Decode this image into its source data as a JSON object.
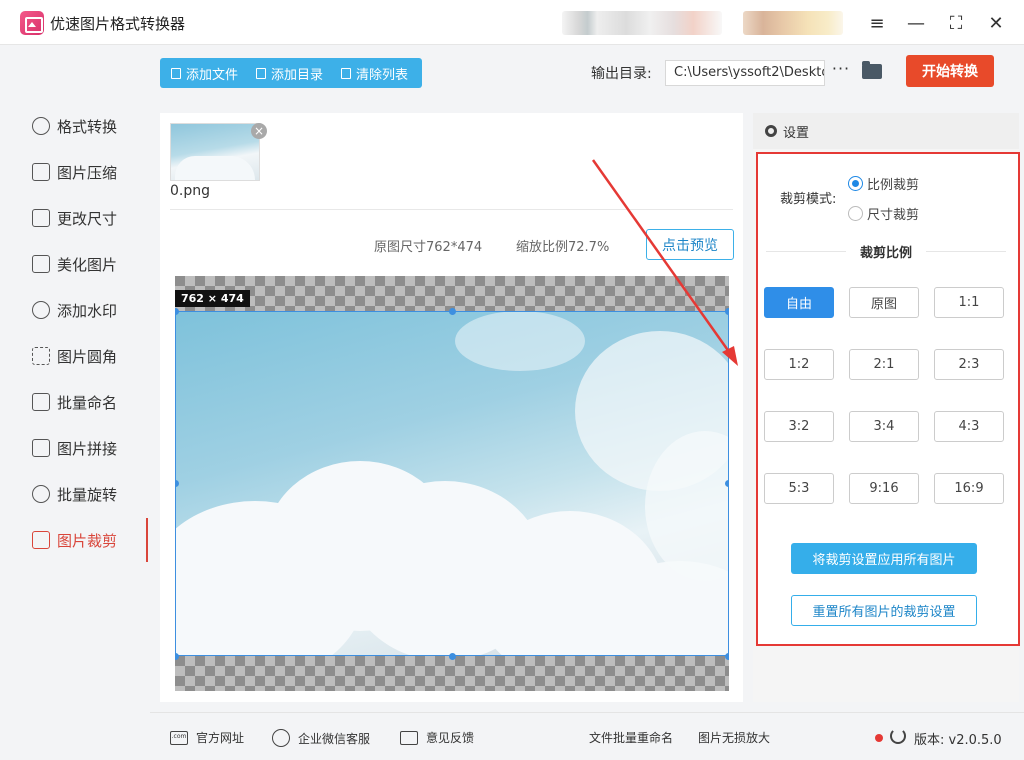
{
  "app": {
    "title": "优速图片格式转换器"
  },
  "window_controls": {
    "menu": "≡",
    "minimize": "—",
    "maximize": "⛶",
    "close": "✕"
  },
  "sidebar": {
    "items": [
      {
        "label": "格式转换",
        "icon": "convert-icon"
      },
      {
        "label": "图片压缩",
        "icon": "compress-icon"
      },
      {
        "label": "更改尺寸",
        "icon": "resize-icon"
      },
      {
        "label": "美化图片",
        "icon": "beautify-icon"
      },
      {
        "label": "添加水印",
        "icon": "watermark-icon"
      },
      {
        "label": "图片圆角",
        "icon": "rounded-corner-icon"
      },
      {
        "label": "批量命名",
        "icon": "rename-icon"
      },
      {
        "label": "图片拼接",
        "icon": "stitch-icon"
      },
      {
        "label": "批量旋转",
        "icon": "rotate-icon"
      },
      {
        "label": "图片裁剪",
        "icon": "crop-icon",
        "active": true
      }
    ]
  },
  "toolbar": {
    "add_file": "添加文件",
    "add_folder": "添加目录",
    "clear_list": "清除列表",
    "output_label": "输出目录:",
    "output_path": "C:\\Users\\yssoft2\\Deskto",
    "more": "···",
    "start": "开始转换"
  },
  "file": {
    "name": "0.png"
  },
  "image_info": {
    "original_size": "原图尺寸762*474",
    "zoom": "缩放比例72.7%",
    "preview": "点击预览"
  },
  "crop": {
    "dimension_tag": "762 × 474"
  },
  "settings": {
    "title": "设置",
    "mode_label": "裁剪模式:",
    "mode_ratio": "比例裁剪",
    "mode_size": "尺寸裁剪",
    "ratio_title": "裁剪比例",
    "ratios": [
      "自由",
      "原图",
      "1:1",
      "1:2",
      "2:1",
      "2:3",
      "3:2",
      "3:4",
      "4:3",
      "5:3",
      "9:16",
      "16:9"
    ],
    "apply_all": "将裁剪设置应用所有图片",
    "reset_all": "重置所有图片的裁剪设置"
  },
  "footer": {
    "website": "官方网址",
    "wechat": "企业微信客服",
    "feedback": "意见反馈",
    "batch_rename": "文件批量重命名",
    "lossless_zoom": "图片无损放大",
    "version": "版本: v2.0.5.0"
  },
  "colors": {
    "accent": "#3db0e8",
    "primary_button": "#e84a2a",
    "active_nav": "#d9453a",
    "annotation": "#e53935"
  }
}
